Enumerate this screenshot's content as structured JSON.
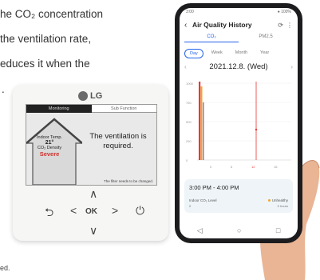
{
  "marketing": {
    "line1": "he CO₂ concentration",
    "line2": "the ventilation rate,",
    "line3": "educes it when the",
    "line4": "."
  },
  "footnote": "ed.",
  "controller": {
    "brand": "LG",
    "tabs": {
      "monitoring": "Monitoring",
      "subfunction": "Sub Function"
    },
    "indoor": {
      "temp_label": "Indoor Temp.",
      "temp_value": "21°",
      "density_label": "CO₂ Density",
      "severity": "Severe"
    },
    "message_line1": "The ventilation is",
    "message_line2": "required.",
    "filter_note": "The filter needs to be changed.",
    "buttons": {
      "up": "∧",
      "down": "∨",
      "left": "<",
      "right": ">",
      "ok": "OK",
      "back": "⮌",
      "power": "⏻"
    }
  },
  "phone": {
    "status_left": "3:00",
    "status_right": "● 100%",
    "app_title": "Air Quality History",
    "tabs": [
      "CO₂",
      "PM2.5"
    ],
    "ranges": [
      "Day",
      "Week",
      "Month",
      "Year"
    ],
    "date": "2021.12.8. (Wed)",
    "chart_ylabels": [
      "1000",
      "750",
      "500",
      "250",
      "0"
    ],
    "chart_xlabels": [
      "0",
      "6",
      "12",
      "18"
    ],
    "card": {
      "time": "3:00 PM - 4:00 PM",
      "indoor_label": "Indoor CO₂ Level",
      "indoor_value": "0",
      "outdoor_label": "Unhealthy",
      "outdoor_value": "0 hours"
    },
    "nav": [
      "◁",
      "○",
      "□"
    ]
  },
  "colors": {
    "accent": "#2563eb",
    "severe": "#d0312d",
    "chart_orange": "#f6a623",
    "chart_red": "#e53935",
    "chart_purple": "#8a7fd4"
  }
}
